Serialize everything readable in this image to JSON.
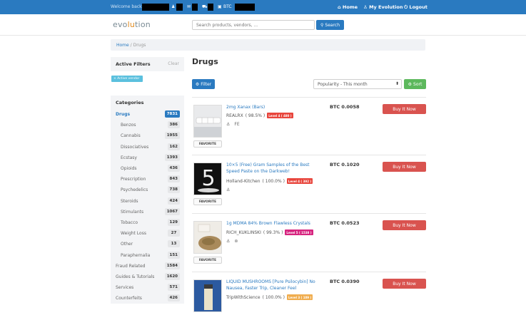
{
  "topbar": {
    "welcome": "Welcome back",
    "btc_label": "BTC",
    "nav": [
      {
        "icon": "home-icon",
        "glyph": "⌂",
        "label": "Home"
      },
      {
        "icon": "user-icon",
        "glyph": "♙",
        "label": "My Evolution"
      },
      {
        "icon": "power-icon",
        "glyph": "⏻",
        "label": "Logout"
      }
    ]
  },
  "brand": {
    "logo_main": "evo",
    "logo_accent": "lu",
    "logo_end": "tion"
  },
  "search": {
    "placeholder": "Search products, vendors, ...",
    "button_label": "Search"
  },
  "breadcrumb": {
    "home": "Home",
    "separator": "/",
    "current": "Drugs"
  },
  "filters": {
    "title": "Active Filters",
    "clear": "Clear",
    "active_tag": "× Active vendor"
  },
  "categories": {
    "title": "Categories",
    "items": [
      {
        "label": "Drugs",
        "count": "7831",
        "active": true,
        "indent": false
      },
      {
        "label": "Benzos",
        "count": "386",
        "indent": true
      },
      {
        "label": "Cannabis",
        "count": "1955",
        "indent": true
      },
      {
        "label": "Dissociatives",
        "count": "162",
        "indent": true
      },
      {
        "label": "Ecstasy",
        "count": "1393",
        "indent": true
      },
      {
        "label": "Opioids",
        "count": "436",
        "indent": true
      },
      {
        "label": "Prescription",
        "count": "843",
        "indent": true
      },
      {
        "label": "Psychedelics",
        "count": "738",
        "indent": true
      },
      {
        "label": "Steroids",
        "count": "424",
        "indent": true
      },
      {
        "label": "Stimulants",
        "count": "1067",
        "indent": true
      },
      {
        "label": "Tobacco",
        "count": "129",
        "indent": true
      },
      {
        "label": "Weight Loss",
        "count": "27",
        "indent": true
      },
      {
        "label": "Other",
        "count": "13",
        "indent": true
      },
      {
        "label": "Paraphernalia",
        "count": "151",
        "indent": true
      },
      {
        "label": "Fraud Related",
        "count": "1584",
        "indent": false
      },
      {
        "label": "Guides & Tutorials",
        "count": "1620",
        "indent": false
      },
      {
        "label": "Services",
        "count": "571",
        "indent": false
      },
      {
        "label": "Counterfeits",
        "count": "426",
        "indent": false
      }
    ]
  },
  "main": {
    "title": "Drugs",
    "filter_button": "Filter",
    "sort_value": "Popularity - This month",
    "sort_button": "Sort"
  },
  "listings": [
    {
      "title": "2mg Xanax (Bars)",
      "vendor": "REALRX",
      "rating": "( 98.5% )",
      "level": "Level 4 ( 480 )",
      "level_color": "#e8453c",
      "ships": "FE",
      "price": "BTC 0.0058",
      "buy": "Buy It Now",
      "favorite": "FAVORITE"
    },
    {
      "title": "10×5 (Free) Gram Samples of the Best Speed Paste on the Darkweb!",
      "vendor": "Holland-Kitchen",
      "rating": "( 100.0% )",
      "level": "Level 4 ( 392 )",
      "level_color": "#e8453c",
      "ships": "",
      "price": "BTC 0.1020",
      "buy": "Buy It Now",
      "favorite": "FAVORITE"
    },
    {
      "title": "1g MDMA 84% Brown Flawless Crystals",
      "vendor": "RICH_KUKLINSKI",
      "rating": "( 99.3% )",
      "level": "Level 5 ( 1538 )",
      "level_color": "#d6247f",
      "ships": "",
      "price": "BTC 0.0523",
      "buy": "Buy It Now",
      "favorite": "FAVORITE"
    },
    {
      "title": "LIQUID MUSHROOMS [Pure Psilocybin] No Nausea, Faster Trip, Cleaner Feel",
      "vendor": "TripWithScience",
      "rating": "( 100.0% )",
      "level": "Level 3 ( 109 )",
      "level_color": "#f0ad4e",
      "ships": "",
      "price": "BTC 0.0390",
      "buy": "Buy It Now",
      "favorite": "FAVORITE"
    }
  ],
  "colors": {
    "primary": "#2a7ac0",
    "danger": "#d9534f",
    "success": "#5cb85c",
    "info": "#5bc0de"
  }
}
